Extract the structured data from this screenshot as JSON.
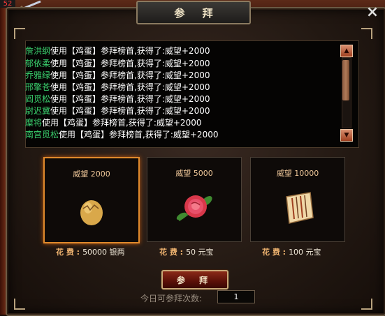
{
  "window": {
    "title": "参 拜",
    "close_icon": "×",
    "corner_badge": "52"
  },
  "log": {
    "entries": [
      {
        "name": "詹洪纲",
        "text": "使用【鸡蛋】参拜榜首,获得了:威望+2000"
      },
      {
        "name": "郁依柔",
        "text": "使用【鸡蛋】参拜榜首,获得了:威望+2000"
      },
      {
        "name": "乔雅绿",
        "text": "使用【鸡蛋】参拜榜首,获得了:威望+2000"
      },
      {
        "name": "邢擎苍",
        "text": "使用【鸡蛋】参拜榜首,获得了:威望+2000"
      },
      {
        "name": "阎觅松",
        "text": "使用【鸡蛋】参拜榜首,获得了:威望+2000"
      },
      {
        "name": "尉迟冀",
        "text": "使用【鸡蛋】参拜榜首,获得了:威望+2000"
      },
      {
        "name": "糜将",
        "text": "使用【鸡蛋】参拜榜首,获得了:威望+2000"
      },
      {
        "name": "南宫觅松",
        "text": "使用【鸡蛋】参拜榜首,获得了:威望+2000"
      }
    ]
  },
  "options": [
    {
      "label": "威望 2000",
      "cost_label": "花 费 :",
      "cost_value": "50000 银两",
      "icon": "egg-icon",
      "selected": true
    },
    {
      "label": "威望 5000",
      "cost_label": "花 费 :",
      "cost_value": "50 元宝",
      "icon": "rose-icon",
      "selected": false
    },
    {
      "label": "威望 10000",
      "cost_label": "花 费 :",
      "cost_value": "100 元宝",
      "icon": "scroll-icon",
      "selected": false
    }
  ],
  "actions": {
    "worship_label": "参 拜"
  },
  "daily": {
    "label": "今日可参拜次数:",
    "count": "1"
  },
  "colors": {
    "name_green": "#3bd36f",
    "selected_border": "#e08a2c",
    "cost_label": "#f0b470"
  }
}
